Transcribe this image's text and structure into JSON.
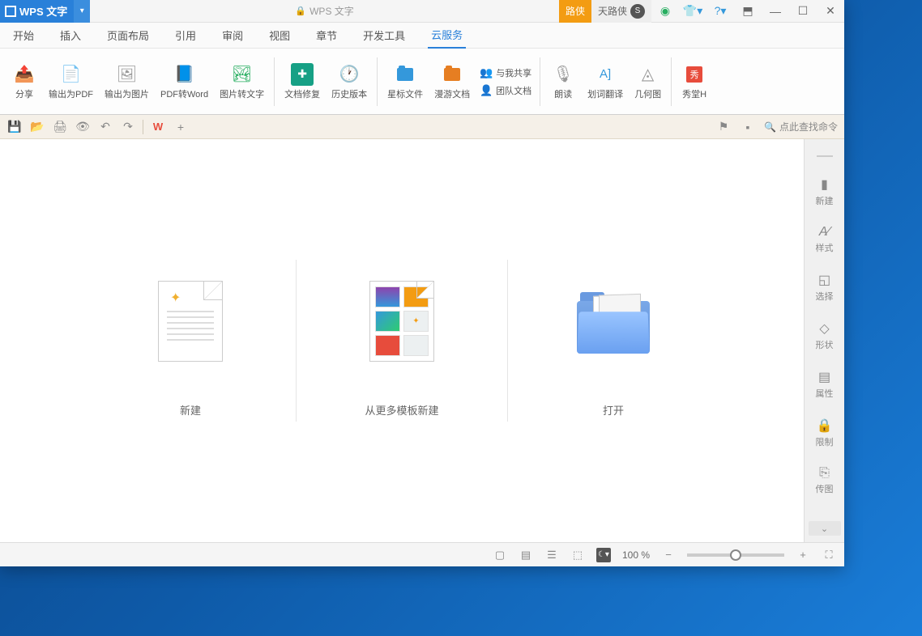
{
  "titlebar": {
    "app_name": "WPS 文字",
    "center_title": "WPS 文字",
    "btn_luxia": "路侠",
    "btn_user": "天路侠"
  },
  "tabs": {
    "start": "开始",
    "insert": "插入",
    "page_layout": "页面布局",
    "references": "引用",
    "review": "审阅",
    "view": "视图",
    "chapters": "章节",
    "dev_tools": "开发工具",
    "cloud": "云服务"
  },
  "ribbon": {
    "share": "分享",
    "output_pdf": "输出为PDF",
    "output_img": "输出为图片",
    "pdf_to_word": "PDF转Word",
    "img_to_text": "图片转文字",
    "doc_repair": "文档修复",
    "history": "历史版本",
    "star_files": "星标文件",
    "roam_docs": "漫游文档",
    "share_with_me": "与我共享",
    "team_docs": "团队文档",
    "read_aloud": "朗读",
    "word_translate": "划词翻译",
    "geometry": "几何图",
    "xiutang": "秀堂H"
  },
  "search": {
    "placeholder": "点此查找命令"
  },
  "start_screen": {
    "new_doc": "新建",
    "from_template": "从更多模板新建",
    "open": "打开"
  },
  "sidebar": {
    "new": "新建",
    "style": "样式",
    "select": "选择",
    "shape": "形状",
    "props": "属性",
    "restrict": "限制",
    "transfer": "传图"
  },
  "statusbar": {
    "zoom": "100 %"
  }
}
